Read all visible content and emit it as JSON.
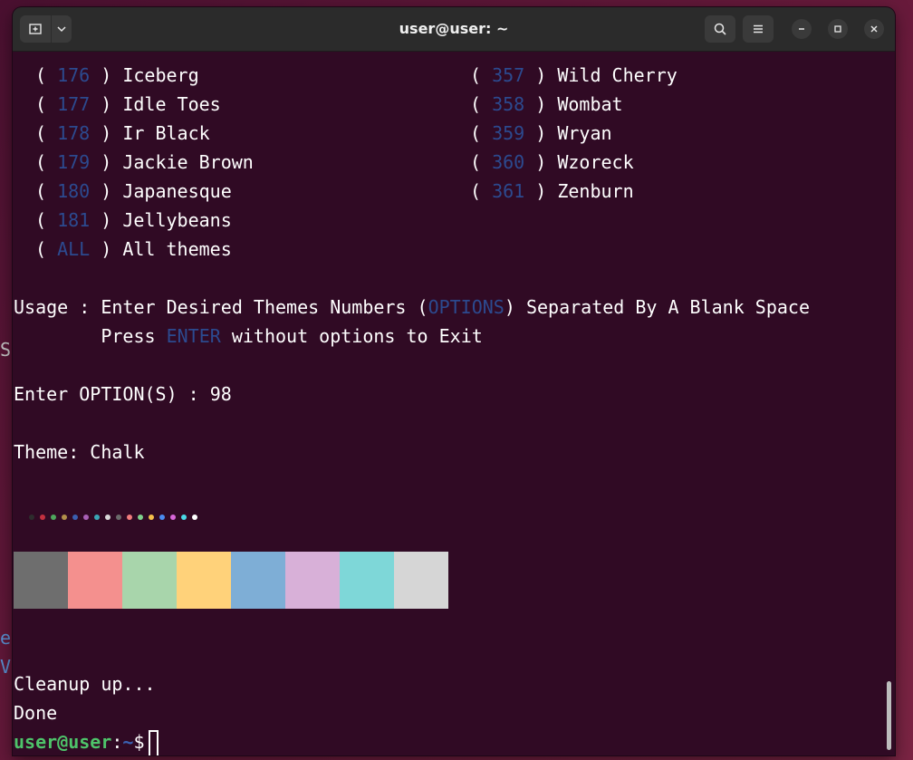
{
  "window": {
    "title": "user@user: ~"
  },
  "desktop_fragments": [
    "S",
    "e",
    "V"
  ],
  "theme_list": {
    "left": [
      {
        "num": "176",
        "name": "Iceberg"
      },
      {
        "num": "177",
        "name": "Idle Toes"
      },
      {
        "num": "178",
        "name": "Ir Black"
      },
      {
        "num": "179",
        "name": "Jackie Brown"
      },
      {
        "num": "180",
        "name": "Japanesque"
      },
      {
        "num": "181",
        "name": "Jellybeans"
      },
      {
        "num": "ALL",
        "name": "All themes"
      }
    ],
    "right": [
      {
        "num": "357",
        "name": "Wild Cherry"
      },
      {
        "num": "358",
        "name": "Wombat"
      },
      {
        "num": "359",
        "name": "Wryan"
      },
      {
        "num": "360",
        "name": "Wzoreck"
      },
      {
        "num": "361",
        "name": "Zenburn"
      }
    ]
  },
  "usage": {
    "prefix": "Usage : Enter Desired Themes Numbers (",
    "options_word": "OPTIONS",
    "suffix": ") Separated By A Blank Space",
    "press": "        Press ",
    "enter_word": "ENTER",
    "press_suffix": " without options to Exit"
  },
  "input_line": "Enter OPTION(S) : 98",
  "theme_line": "Theme: Chalk",
  "palette_dots": [
    "#2d2d2d",
    "#c2303f",
    "#4ea65d",
    "#b28f4a",
    "#3a5fb0",
    "#a85fb5",
    "#3aa6b5",
    "#d9d9d9",
    "#6a6a6a",
    "#f07c7c",
    "#7fd18d",
    "#f5c04a",
    "#4a8cf0",
    "#d966d9",
    "#4ad9e6",
    "#ffffff"
  ],
  "palette_swatches": [
    "#6e6e6e",
    "#f4908e",
    "#a8d5ab",
    "#ffd27a",
    "#7eaed6",
    "#d8b0d8",
    "#7ed7d8",
    "#d6d6d6"
  ],
  "output": {
    "cleanup": "Cleanup up...",
    "done": "Done"
  },
  "prompt": {
    "user": "user@user",
    "colon": ":",
    "path": "~",
    "symbol": "$"
  }
}
